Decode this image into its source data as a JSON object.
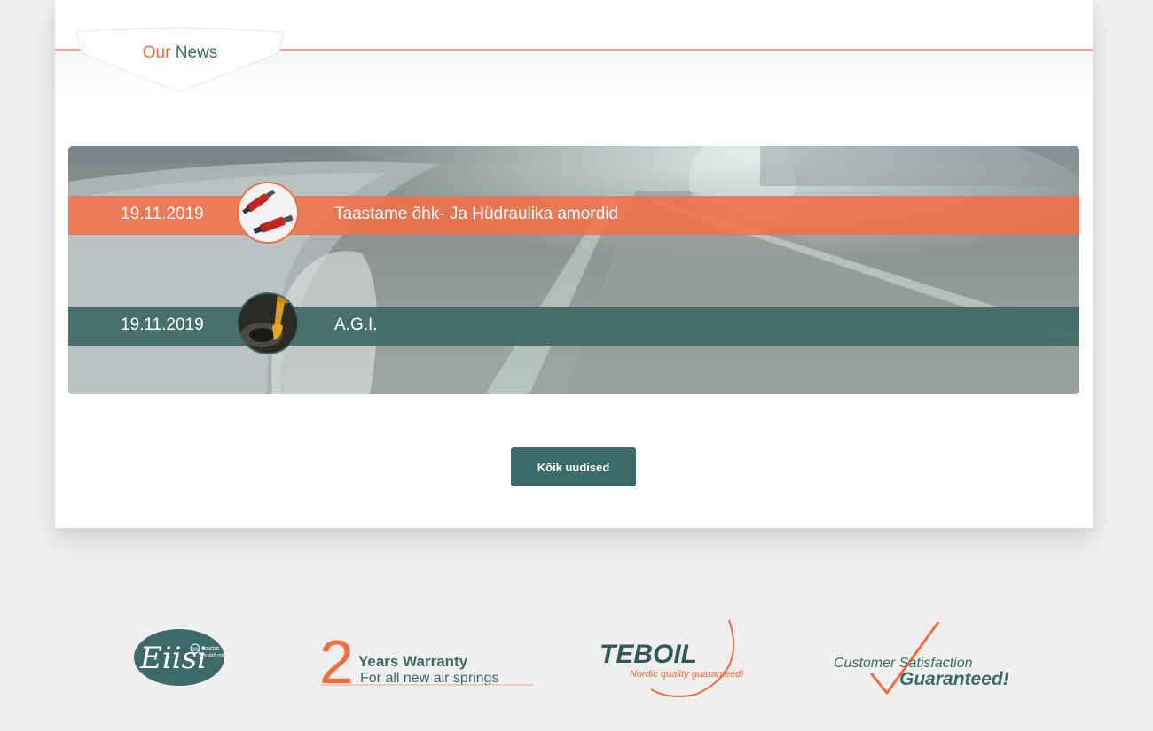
{
  "news_section": {
    "title_accent": "Our",
    "title_main": "News"
  },
  "news": [
    {
      "date": "19.11.2019",
      "title": "Taastame õhk- Ja Hüdraulika amordid",
      "thumb_icon": "shock-absorber-icon"
    },
    {
      "date": "19.11.2019",
      "title": "A.G.I.",
      "thumb_icon": "oil-pour-icon"
    }
  ],
  "all_news_button": {
    "label": "Kõik uudised"
  },
  "partners": {
    "eiisi": {
      "script": "Eiisi",
      "years": "20",
      "line1": "aastat",
      "line2": "usaldust"
    },
    "warranty": {
      "number": "2",
      "line1": "Years Warranty",
      "line2": "For all new air springs"
    },
    "teboil": {
      "name": "TEBOIL",
      "tagline": "Nordic quality guaranteed!"
    },
    "satisfaction": {
      "line1": "Customer Satisfaction",
      "line2": "Guaranteed!"
    }
  },
  "colors": {
    "accent_orange": "#f26d3d",
    "brand_teal": "#3c6a6a",
    "page_background": "#efefef"
  }
}
